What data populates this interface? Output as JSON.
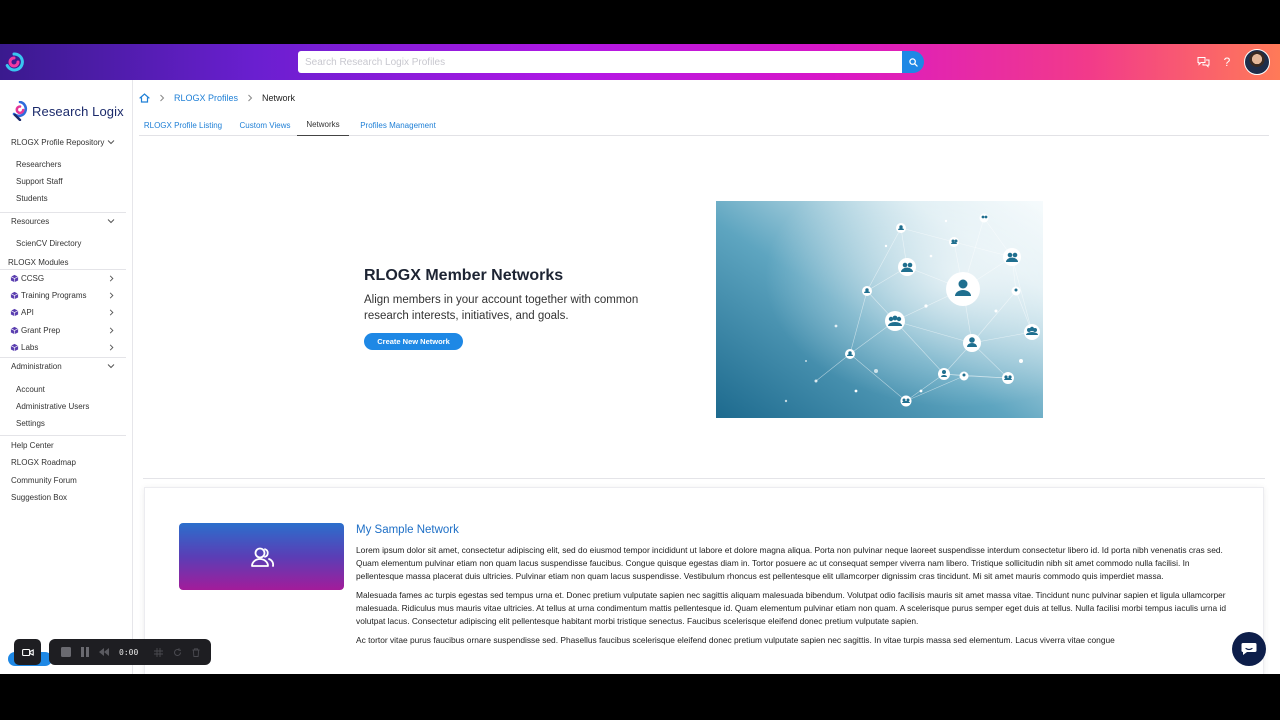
{
  "topbar": {
    "search": {
      "placeholder": "Search Research Logix Profiles",
      "value": ""
    },
    "icons": [
      "app-logo-icon",
      "search-icon",
      "chat-icon",
      "help-icon"
    ],
    "help_label": "?",
    "gradient": [
      "#3a1a8e",
      "#b218e6",
      "#f23a8a",
      "#ff7a58"
    ]
  },
  "sidebar": {
    "brand": "Research Logix",
    "repository": {
      "label": "RLOGX Profile Repository",
      "items": [
        "Researchers",
        "Support Staff",
        "Students"
      ]
    },
    "resources": {
      "label": "Resources",
      "items": [
        "ScienCV Directory"
      ]
    },
    "modules": {
      "label": "RLOGX Modules",
      "items": [
        "CCSG",
        "Training Programs",
        "API",
        "Grant Prep",
        "Labs"
      ]
    },
    "administration": {
      "label": "Administration",
      "items": [
        "Account",
        "Administrative Users",
        "Settings"
      ]
    },
    "links": [
      "Help Center",
      "RLOGX Roadmap",
      "Community Forum",
      "Suggestion Box"
    ]
  },
  "main": {
    "breadcrumb": {
      "home_icon": "home-icon",
      "items": [
        "RLOGX Profiles",
        "Network"
      ]
    },
    "tabs": [
      "RLOGX Profile Listing",
      "Custom Views",
      "Networks",
      "Profiles Management"
    ],
    "active_tab": "Networks",
    "hero": {
      "title": "RLOGX Member Networks",
      "subtitle": "Align members in your account together with common research interests, initiatives, and goals.",
      "button": "Create New Network",
      "image_icon": "network-graph-illustration"
    },
    "network_card": {
      "title": "My Sample Network",
      "thumb_icon": "users-icon",
      "paragraphs": [
        "Lorem ipsum dolor sit amet, consectetur adipiscing elit, sed do eiusmod tempor incididunt ut labore et dolore magna aliqua. Porta non pulvinar neque laoreet suspendisse interdum consectetur libero id. Id porta nibh venenatis cras sed. Quam elementum pulvinar etiam non quam lacus suspendisse faucibus. Congue quisque egestas diam in. Tortor posuere ac ut consequat semper viverra nam libero. Tristique sollicitudin nibh sit amet commodo nulla facilisi. In pellentesque massa placerat duis ultricies. Pulvinar etiam non quam lacus suspendisse. Vestibulum rhoncus est pellentesque elit ullamcorper dignissim cras tincidunt. Mi sit amet mauris commodo quis imperdiet massa.",
        "Malesuada fames ac turpis egestas sed tempus urna et. Donec pretium vulputate sapien nec sagittis aliquam malesuada bibendum. Volutpat odio facilisis mauris sit amet massa vitae. Tincidunt nunc pulvinar sapien et ligula ullamcorper malesuada. Ridiculus mus mauris vitae ultricies. At tellus at urna condimentum mattis pellentesque id. Quam elementum pulvinar etiam non quam. A scelerisque purus semper eget duis at tellus. Nulla facilisi morbi tempus iaculis urna id volutpat lacus. Consectetur adipiscing elit pellentesque habitant morbi tristique senectus. Faucibus scelerisque eleifend donec pretium vulputate sapien.",
        "Ac tortor vitae purus faucibus ornare suspendisse sed. Phasellus faucibus scelerisque eleifend donec pretium vulputate sapien nec sagittis. In vitae turpis massa sed elementum. Lacus viverra vitae congue"
      ]
    }
  },
  "recorder": {
    "time": "0:00",
    "icons": [
      "camera-icon",
      "stop-icon",
      "pause-icon",
      "rewind-icon",
      "grid-icon",
      "refresh-icon",
      "trash-icon"
    ]
  },
  "colors": {
    "accent": "#1e88e5",
    "link": "#1e7fd6",
    "brand_navy": "#1b2a6b",
    "chat_fab": "#0d1e4a"
  }
}
